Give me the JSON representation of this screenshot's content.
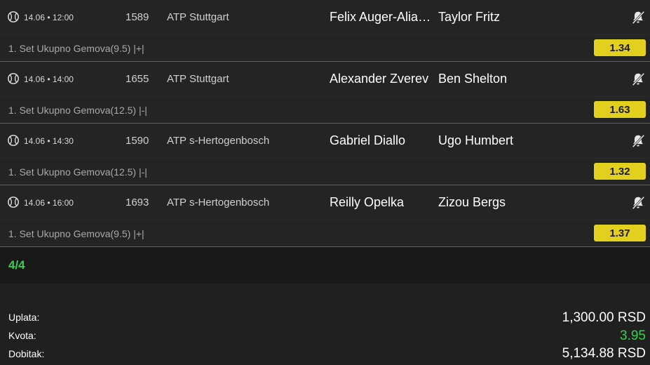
{
  "matches": [
    {
      "datetime": "14.06 • 12:00",
      "code": "1589",
      "league": "ATP Stuttgart",
      "home": "Felix Auger-Aliassime",
      "away": "Taylor Fritz",
      "market": "1. Set Ukupno Gemova(9.5) |+|",
      "odd": "1.34"
    },
    {
      "datetime": "14.06 • 14:00",
      "code": "1655",
      "league": "ATP Stuttgart",
      "home": "Alexander Zverev",
      "away": "Ben Shelton",
      "market": "1. Set Ukupno Gemova(12.5) |-|",
      "odd": "1.63"
    },
    {
      "datetime": "14.06 • 14:30",
      "code": "1590",
      "league": "ATP s-Hertogenbosch",
      "home": "Gabriel Diallo",
      "away": "Ugo Humbert",
      "market": "1. Set Ukupno Gemova(12.5) |-|",
      "odd": "1.32"
    },
    {
      "datetime": "14.06 • 16:00",
      "code": "1693",
      "league": "ATP s-Hertogenbosch",
      "home": "Reilly Opelka",
      "away": "Zizou Bergs",
      "market": "1. Set Ukupno Gemova(9.5) |+|",
      "odd": "1.37"
    }
  ],
  "count": "4/4",
  "summary": {
    "stake_label": "Uplata:",
    "stake_value": "1,300.00 RSD",
    "odds_label": "Kvota:",
    "odds_value": "3.95",
    "win_label": "Dobitak:",
    "win_value": "5,134.88 RSD"
  },
  "icons": {
    "sport": "tennis-ball-icon",
    "notification": "bell-off-icon"
  },
  "colors": {
    "odd_bg": "#e3cf1d",
    "accent_green": "#37d04f",
    "divider_green": "#1e8a3a"
  }
}
